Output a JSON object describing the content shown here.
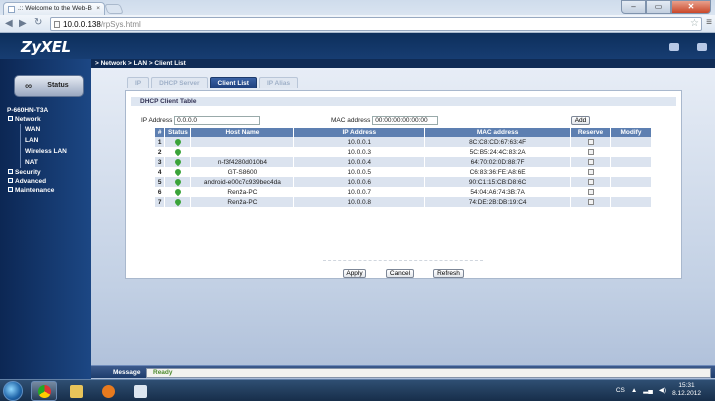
{
  "browser": {
    "tab_title": ".:: Welcome to the Web-B",
    "tab_close": "×",
    "url_domain": "10.0.0.138",
    "url_path": "/rpSys.html",
    "back": "◀",
    "forward": "▶",
    "reload": "↻"
  },
  "window": {
    "minimize": "–",
    "maximize": "▭",
    "close": "✕"
  },
  "brand": {
    "logo": "ZyXEL"
  },
  "breadcrumb": "> Network > LAN > Client List",
  "sidebar": {
    "status_label": "Status",
    "device": "P-660HN-T3A",
    "items": [
      {
        "label": "Network",
        "type": "top"
      },
      {
        "label": "WAN",
        "type": "sub"
      },
      {
        "label": "LAN",
        "type": "sub"
      },
      {
        "label": "Wireless LAN",
        "type": "sub"
      },
      {
        "label": "NAT",
        "type": "sub"
      },
      {
        "label": "Security",
        "type": "top"
      },
      {
        "label": "Advanced",
        "type": "top"
      },
      {
        "label": "Maintenance",
        "type": "top"
      }
    ]
  },
  "tabs": [
    "IP",
    "DHCP Server",
    "Client List",
    "IP Alias"
  ],
  "active_tab": "Client List",
  "panel": {
    "title": "DHCP Client Table",
    "ip_label": "IP Address",
    "ip_value": "0.0.0.0",
    "mac_label": "MAC address",
    "mac_value": "00:00:00:00:00:00",
    "add_label": "Add"
  },
  "table": {
    "headers": [
      "#",
      "Status",
      "Host Name",
      "IP Address",
      "MAC address",
      "Reserve",
      "Modify"
    ],
    "rows": [
      {
        "n": "1",
        "host": "",
        "ip": "10.0.0.1",
        "mac": "8C:C8:CD:67:63:4F"
      },
      {
        "n": "2",
        "host": "",
        "ip": "10.0.0.3",
        "mac": "5C:B5:24:4C:83:2A"
      },
      {
        "n": "3",
        "host": "n-f3f4280d010b4",
        "ip": "10.0.0.4",
        "mac": "64:70:02:0D:88:7F"
      },
      {
        "n": "4",
        "host": "GT-S8600",
        "ip": "10.0.0.5",
        "mac": "C6:83:36:FE:A8:6E"
      },
      {
        "n": "5",
        "host": "android-e00c7c939bec4da",
        "ip": "10.0.0.6",
        "mac": "90:C1:15:CB:D8:6C"
      },
      {
        "n": "6",
        "host": "Renža-PC",
        "ip": "10.0.0.7",
        "mac": "54:04:A6:74:3B:7A"
      },
      {
        "n": "7",
        "host": "Renža-PC",
        "ip": "10.0.0.8",
        "mac": "74:DE:2B:DB:19:C4"
      }
    ]
  },
  "buttons": {
    "apply": "Apply",
    "cancel": "Cancel",
    "refresh": "Refresh"
  },
  "message": {
    "label": "Message",
    "value": "Ready"
  },
  "taskbar": {
    "lang": "CS",
    "time": "15:31",
    "date": "8.12.2012"
  },
  "colors": {
    "header_bg": "#0d2f5c",
    "accent": "#5d7fb1",
    "status_ok": "#3aa33a",
    "ready_text": "#4e8b2f"
  }
}
